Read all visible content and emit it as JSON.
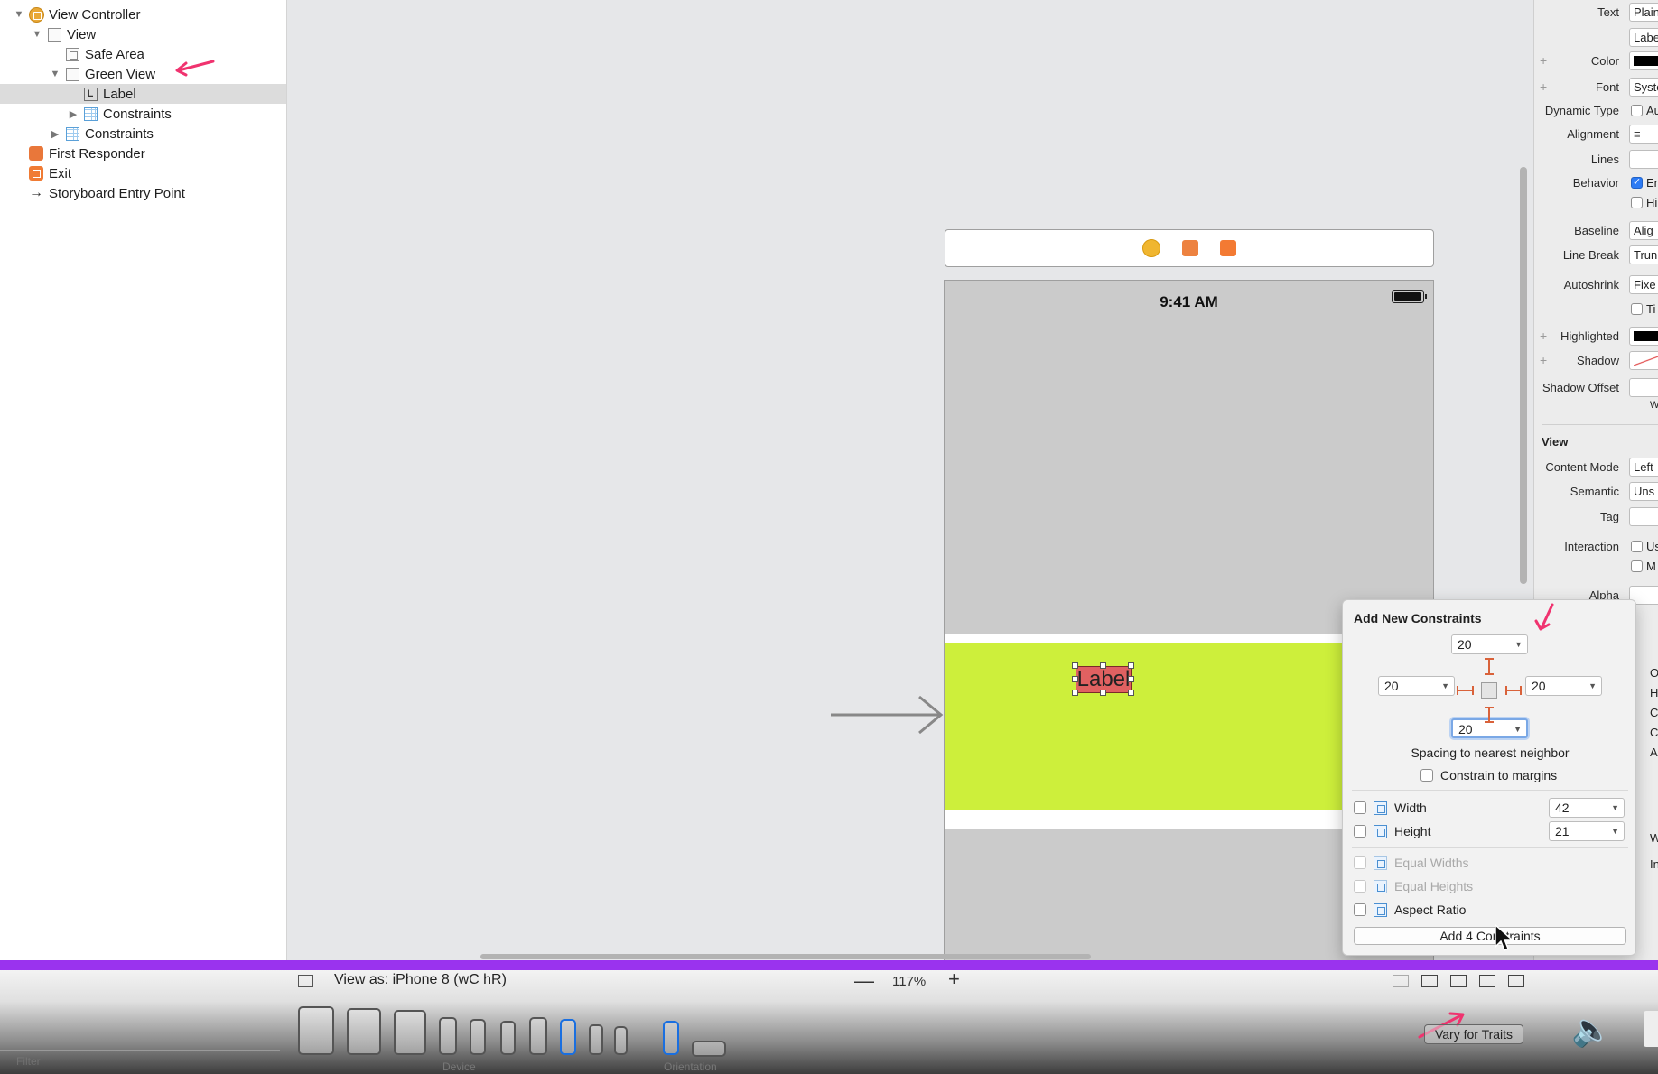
{
  "outline": {
    "items": [
      {
        "label": "View Controller"
      },
      {
        "label": "View"
      },
      {
        "label": "Safe Area"
      },
      {
        "label": "Green View"
      },
      {
        "label": "Label"
      },
      {
        "label": "Constraints"
      },
      {
        "label": "Constraints"
      },
      {
        "label": "First Responder"
      },
      {
        "label": "Exit"
      },
      {
        "label": "Storyboard Entry Point"
      }
    ]
  },
  "canvas": {
    "status_time": "9:41 AM",
    "label_text": "Label",
    "colors": {
      "green_view": "#cdef3b",
      "label_bg": "#e06161",
      "accent": "#9a33ee"
    }
  },
  "inspector": {
    "rows": {
      "text": {
        "label": "Text",
        "value": "Plain"
      },
      "text2": {
        "value": "Label"
      },
      "color": {
        "label": "Color"
      },
      "font": {
        "label": "Font",
        "value": "System"
      },
      "dynamic_type": {
        "label": "Dynamic Type",
        "check": "Au"
      },
      "alignment": {
        "label": "Alignment"
      },
      "lines": {
        "label": "Lines"
      },
      "behavior": {
        "label": "Behavior",
        "check1": "En",
        "check2": "Hi"
      },
      "baseline": {
        "label": "Baseline",
        "value": "Alig"
      },
      "line_break": {
        "label": "Line Break",
        "value": "Trun"
      },
      "autoshrink": {
        "label": "Autoshrink",
        "value": "Fixe",
        "check": "Ti"
      },
      "highlighted": {
        "label": "Highlighted"
      },
      "shadow": {
        "label": "Shadow"
      },
      "shadow_offset": {
        "label": "Shadow Offset",
        "w": "W"
      },
      "view_section": "View",
      "content_mode": {
        "label": "Content Mode",
        "value": "Left"
      },
      "semantic": {
        "label": "Semantic",
        "value": "Uns"
      },
      "tag": {
        "label": "Tag"
      },
      "interaction": {
        "label": "Interaction",
        "check1": "Us",
        "check2": "M"
      },
      "alpha": {
        "label": "Alpha"
      },
      "right_fragments": [
        "Op",
        "Hi",
        "Cl",
        "Cl",
        "Au",
        "W",
        "In"
      ]
    }
  },
  "popover": {
    "title": "Add New Constraints",
    "top": "20",
    "left": "20",
    "right": "20",
    "bottom": "20",
    "caption": "Spacing to nearest neighbor",
    "constrain_margins": "Constrain to margins",
    "width_label": "Width",
    "width_value": "42",
    "height_label": "Height",
    "height_value": "21",
    "equal_widths": "Equal Widths",
    "equal_heights": "Equal Heights",
    "aspect_ratio": "Aspect Ratio",
    "add_button": "Add 4 Constraints"
  },
  "toolbar": {
    "view_as": "View as: iPhone 8 (wC hR)",
    "zoom_minus": "—",
    "zoom": "117%",
    "zoom_plus": "+",
    "device_caption": "Device",
    "orientation_caption": "Orientation",
    "vary_for_traits": "Vary for Traits",
    "filter_placeholder": "Filter"
  }
}
